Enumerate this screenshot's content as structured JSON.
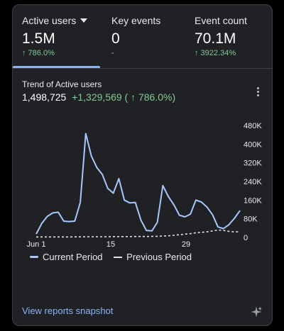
{
  "metrics": [
    {
      "label": "Active users",
      "value": "1.5M",
      "change": "↑ 786.0%",
      "has_dropdown": true,
      "selected": true
    },
    {
      "label": "Key events",
      "value": "0",
      "change": "-",
      "has_dropdown": false,
      "selected": false
    },
    {
      "label": "Event count",
      "value": "70.1M",
      "change": "↑ 3922.34%",
      "has_dropdown": false,
      "selected": false
    }
  ],
  "trend": {
    "title": "Trend of Active users",
    "total": "1,498,725",
    "delta": "+1,329,569 ( ↑ 786.0%)"
  },
  "chart_data": {
    "type": "line",
    "x_tick_labels": [
      "Jun 1",
      "15",
      "29"
    ],
    "y_tick_labels": [
      "480K",
      "400K",
      "320K",
      "240K",
      "160K",
      "80K",
      "0"
    ],
    "ylim": [
      0,
      480000
    ],
    "x_count": 30,
    "series": [
      {
        "name": "Current Period",
        "style": "solid",
        "color": "#a8c7fa",
        "values": [
          15000,
          60000,
          90000,
          105000,
          108000,
          70000,
          68000,
          70000,
          150000,
          445000,
          350000,
          300000,
          270000,
          210000,
          190000,
          252000,
          160000,
          148000,
          150000,
          75000,
          30000,
          28000,
          65000,
          222000,
          175000,
          140000,
          95000,
          88000,
          100000,
          160000,
          152000,
          130000,
          98000,
          45000,
          38000,
          55000,
          82000,
          115000
        ]
      },
      {
        "name": "Previous Period",
        "style": "dashed",
        "color": "#e3e3e3",
        "values": [
          2000,
          2000,
          2000,
          2000,
          2000,
          2000,
          2000,
          2500,
          2500,
          3000,
          3000,
          3000,
          3000,
          3000,
          3500,
          3500,
          3500,
          3500,
          4000,
          4000,
          4000,
          4500,
          5000,
          6000,
          7000,
          9000,
          12000,
          14000,
          16000,
          20000,
          22000,
          24000,
          28000,
          32000,
          30000,
          26000,
          24000,
          24000
        ]
      }
    ],
    "grid": false,
    "legend_position": "bottom-left"
  },
  "legend": {
    "current": "Current Period",
    "previous": "Previous Period"
  },
  "footer": {
    "link": "View reports snapshot"
  },
  "icons": {
    "menu": "more-vert-icon",
    "insights": "sparkle-icon"
  },
  "colors": {
    "accent": "#8ab4f8",
    "positive": "#81c995",
    "line": "#a8c7fa"
  }
}
